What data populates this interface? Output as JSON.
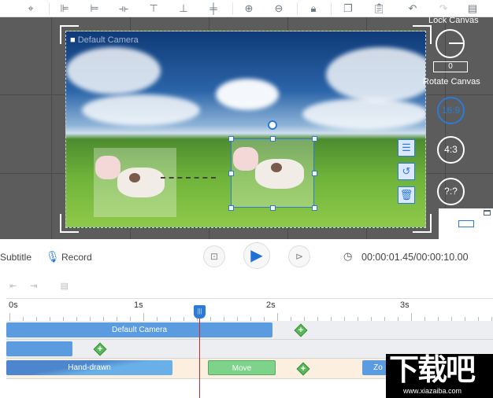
{
  "toolbar": {
    "icons": [
      "location-lock-icon",
      "align-left-icon",
      "align-right-icon",
      "align-center-vertical-icon",
      "align-top-icon",
      "align-bottom-icon",
      "align-center-horizontal-icon",
      "zoom-in-icon",
      "zoom-out-icon",
      "lock-icon",
      "copy-icon",
      "paste-icon",
      "undo-icon",
      "redo-icon",
      "timeline-settings-icon"
    ]
  },
  "canvas": {
    "camera_label": "Default Camera"
  },
  "right_panel": {
    "lock_canvas": "Lock Canvas",
    "rotate_value": "0",
    "rotate_canvas": "Rotate Canvas",
    "ratios": [
      "16:9",
      "4:3",
      "?:?"
    ],
    "active_ratio": "16:9"
  },
  "controls": {
    "subtitle": "Subtitle",
    "record": "Record",
    "time": "00:00:01.45/00:00:10.00"
  },
  "timeline": {
    "ruler": [
      "0s",
      "1s",
      "2s",
      "3s"
    ],
    "tracks": [
      {
        "bars": [
          {
            "label": "Default Camera"
          }
        ]
      },
      {
        "bars": [
          {
            "label": ""
          }
        ]
      },
      {
        "bars": [
          {
            "label": "Hand-drawn"
          },
          {
            "label": "Move"
          },
          {
            "label": "Zo"
          }
        ]
      }
    ]
  },
  "watermark": {
    "text": "下载吧",
    "url": "www.xiazaiba.com"
  },
  "colors": {
    "accent": "#2e7bd6",
    "bar_blue": "#5b9be0",
    "bar_green": "#7dd38a",
    "track_beige": "#fcefe0"
  }
}
